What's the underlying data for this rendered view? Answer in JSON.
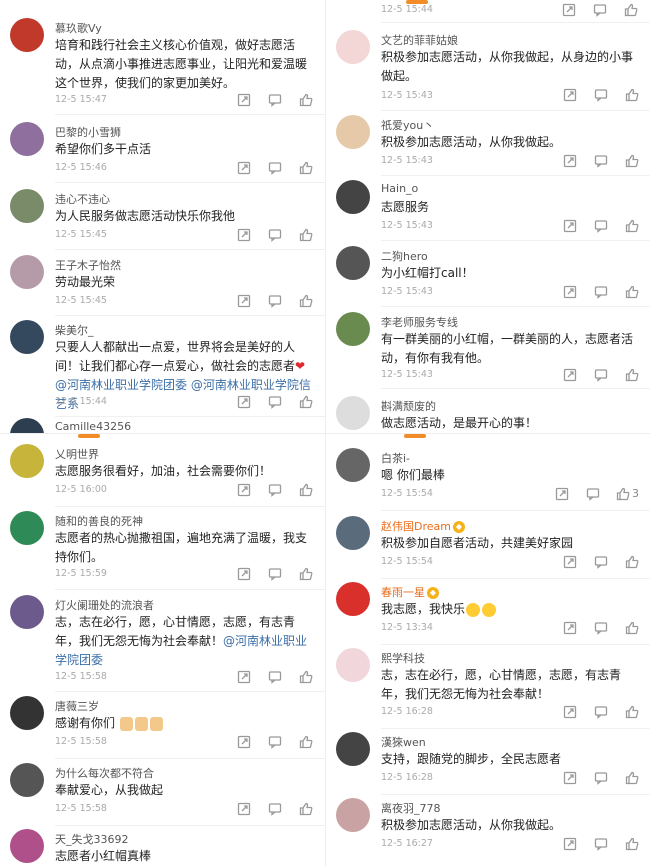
{
  "top_left": [
    {
      "name": "慕玖歌Vy",
      "text": "培育和践行社会主义核心价值观，做好志愿活动，从点滴小事推进志愿事业，让阳光和爱温暖这个世界，使我们的家更加美好。",
      "time": "12-5 15:47",
      "avatar_color": "#c0392b"
    },
    {
      "name": "巴黎的小雪狮",
      "text": "希望你们多干点活",
      "time": "12-5 15:46",
      "avatar_color": "#8e6f9e"
    },
    {
      "name": "违心不违心",
      "text": "为人民服务做志愿活动快乐你我他",
      "time": "12-5 15:45",
      "avatar_color": "#7a8b6a"
    },
    {
      "name": "王子木子怡然",
      "text": "劳动最光荣",
      "time": "12-5 15:45",
      "avatar_color": "#b59aa7"
    },
    {
      "name": "柴美尔_",
      "text_before": "只要人人都献出一点爱，世界将会是美好的人间！让我们都心存一点爱心，做社会的志愿者",
      "mention": "@河南林业职业学院团委 @河南林业职业学院信艺系",
      "time": "12-5 15:44",
      "avatar_color": "#34495e"
    },
    {
      "name": "Camille43256",
      "avatar_color": "#2c3e50"
    }
  ],
  "top_right": [
    {
      "cut_time": "12-5 15:44"
    },
    {
      "name": "文艺的菲菲姑娘",
      "text": "积极参加志愿活动，从你我做起，从身边的小事做起。",
      "time": "12-5 15:43",
      "avatar_color": "#f3d6d6"
    },
    {
      "name": "祇爱you丶",
      "text": "积极参加志愿活动，从你我做起。",
      "time": "12-5 15:43",
      "avatar_color": "#e6c9a8"
    },
    {
      "name": "Hain_o",
      "text": "志愿服务",
      "time": "12-5 15:43",
      "avatar_color": "#444"
    },
    {
      "name": "二狗hero",
      "text": "为小红帽打call！",
      "time": "12-5 15:43",
      "avatar_color": "#555"
    },
    {
      "name": "李老师服务专线",
      "text": "有一群美丽的小红帽，一群美丽的人，志愿者活动，有你有我有他。",
      "time": "12-5 15:43",
      "avatar_color": "#6a8b4f"
    },
    {
      "name": "斟满颓废的",
      "text": "做志愿活动，是最开心的事！",
      "avatar_color": "#ddd"
    }
  ],
  "bottom_left": [
    {
      "name": "乂明世界",
      "text": "志愿服务很看好，加油，社会需要你们！",
      "time": "12-5 16:00",
      "avatar_color": "#c7b43a"
    },
    {
      "name": "随和的善良的死神",
      "text": "志愿者的热心抛撒祖国，遍地充满了温暖，我支持你们。",
      "time": "12-5 15:59",
      "avatar_color": "#2e8b57"
    },
    {
      "name": "灯火阑珊处的流浪者",
      "text_before": "志，志在必行，愿，心甘情愿，志愿，有志青年，我们无怨无悔为社会奉献！",
      "mention": "@河南林业职业学院团委",
      "time": "12-5 15:58",
      "avatar_color": "#6d5a8c"
    },
    {
      "name": "唐薇三岁",
      "text": "感谢有你们",
      "time": "12-5 15:58",
      "avatar_color": "#333"
    },
    {
      "name": "为什么每次都不符合",
      "text": "奉献爱心，从我做起",
      "time": "12-5 15:58",
      "avatar_color": "#555"
    },
    {
      "name": "天_失戈33692",
      "text": "志愿者小红帽真棒",
      "avatar_color": "#b0508a"
    }
  ],
  "bottom_right": [
    {
      "name": "白茶i-",
      "text": "嗯 你们最棒",
      "time": "12-5 15:54",
      "likes": "3",
      "avatar_color": "#666"
    },
    {
      "name": "赵伟国Dream",
      "text": "积极参加自愿者活动，共建美好家园",
      "time": "12-5 15:54",
      "avatar_color": "#5a6b7c"
    },
    {
      "name": "春雨一星",
      "text": "我志愿，我快乐",
      "time": "12-5 13:34",
      "avatar_color": "#d9302c"
    },
    {
      "name": "熙学科技",
      "text": "志，志在必行，愿，心甘情愿，志愿，有志青年，我们无怨无悔为社会奉献！",
      "time": "12-5 16:28",
      "avatar_color": "#f1d7dc"
    },
    {
      "name": "漢猍wen",
      "text": "支持，跟随党的脚步，全民志愿者",
      "time": "12-5 16:28",
      "avatar_color": "#444"
    },
    {
      "name": "离夜羽_778",
      "text": "积极参加志愿活动，从你我做起。",
      "time": "12-5 16:27",
      "avatar_color": "#c9a3a3"
    }
  ]
}
